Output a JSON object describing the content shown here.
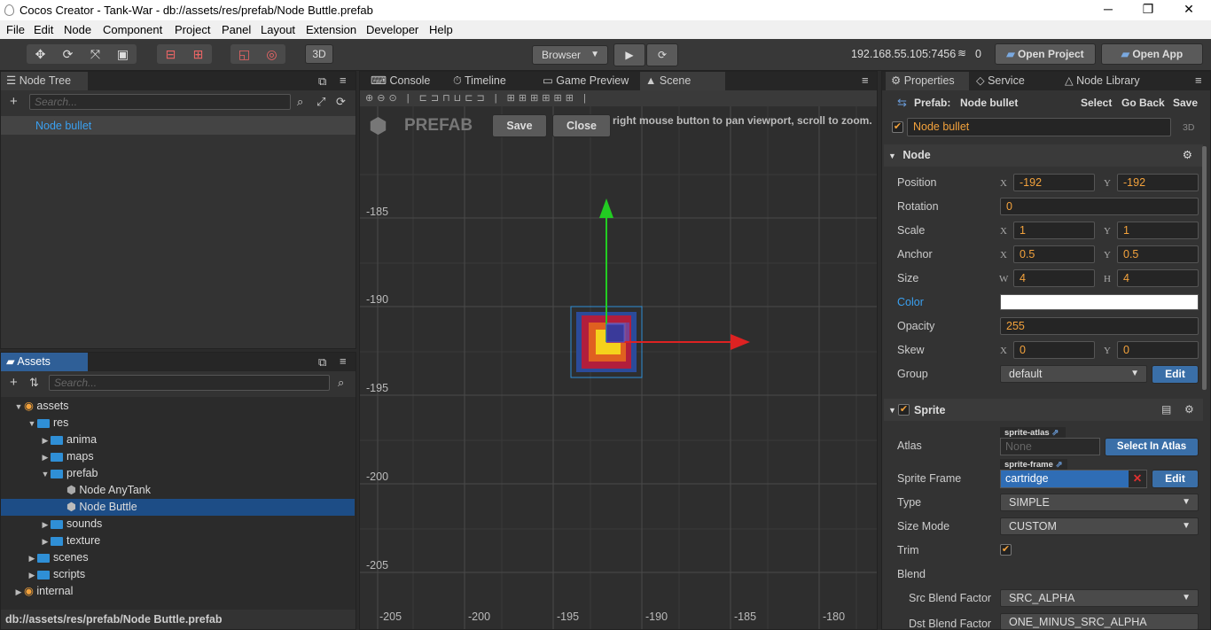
{
  "window": {
    "title": "Cocos Creator - Tank-War - db://assets/res/prefab/Node Buttle.prefab",
    "minimize": "─",
    "maximize": "❐",
    "close": "✕"
  },
  "menu": [
    "File",
    "Edit",
    "Node",
    "Component",
    "Project",
    "Panel",
    "Layout",
    "Extension",
    "Developer",
    "Help"
  ],
  "toolbar": {
    "mode3d": "3D",
    "browser": "Browser",
    "ip": "192.168.55.105:7456",
    "clients": "0",
    "open_project": "Open Project",
    "open_app": "Open App"
  },
  "node_tree": {
    "title": "Node Tree",
    "search_placeholder": "Search...",
    "items": [
      "Node bullet"
    ]
  },
  "assets": {
    "title": "Assets",
    "search_placeholder": "Search...",
    "path": "db://assets/res/prefab/Node Buttle.prefab",
    "items": [
      {
        "label": "assets"
      },
      {
        "label": "res"
      },
      {
        "label": "anima"
      },
      {
        "label": "maps"
      },
      {
        "label": "prefab"
      },
      {
        "label": "Node AnyTank"
      },
      {
        "label": "Node Buttle"
      },
      {
        "label": "sounds"
      },
      {
        "label": "texture"
      },
      {
        "label": "scenes"
      },
      {
        "label": "scripts"
      },
      {
        "label": "internal"
      }
    ]
  },
  "center_tabs": {
    "console": "Console",
    "timeline": "Timeline",
    "game_preview": "Game Preview",
    "scene": "Scene"
  },
  "scene": {
    "prefab_label": "PREFAB",
    "save": "Save",
    "close": "Close",
    "hint": "right mouse button to pan viewport, scroll to zoom.",
    "y_labels": [
      "-185",
      "-190",
      "-195",
      "-200",
      "-205"
    ],
    "x_labels": [
      "-205",
      "-200",
      "-195",
      "-190",
      "-185",
      "-180"
    ]
  },
  "right_tabs": {
    "properties": "Properties",
    "service": "Service",
    "node_library": "Node Library"
  },
  "properties": {
    "prefab_label": "Prefab:",
    "prefab_name": "Node bullet",
    "select": "Select",
    "go_back": "Go Back",
    "save": "Save",
    "node_name": "Node bullet",
    "badge3d": "3D",
    "node_section": "Node",
    "position_label": "Position",
    "pos_x": "-192",
    "pos_y": "-192",
    "rotation_label": "Rotation",
    "rotation": "0",
    "scale_label": "Scale",
    "scale_x": "1",
    "scale_y": "1",
    "anchor_label": "Anchor",
    "anchor_x": "0.5",
    "anchor_y": "0.5",
    "size_label": "Size",
    "size_w": "4",
    "size_h": "4",
    "color_label": "Color",
    "color_value": "#ffffff",
    "opacity_label": "Opacity",
    "opacity": "255",
    "skew_label": "Skew",
    "skew_x": "0",
    "skew_y": "0",
    "group_label": "Group",
    "group": "default",
    "group_edit": "Edit",
    "sprite_section": "Sprite",
    "atlas_label": "Atlas",
    "atlas_tag": "sprite-atlas",
    "atlas_value": "None",
    "select_in_atlas": "Select In Atlas",
    "sprite_frame_label": "Sprite Frame",
    "frame_tag": "sprite-frame",
    "frame_value": "cartridge",
    "frame_edit": "Edit",
    "type_label": "Type",
    "type": "SIMPLE",
    "size_mode_label": "Size Mode",
    "size_mode": "CUSTOM",
    "trim_label": "Trim",
    "blend_label": "Blend",
    "src_blend_label": "Src Blend Factor",
    "src_blend": "SRC_ALPHA",
    "dst_blend_label": "Dst Blend Factor",
    "dst_blend": "ONE_MINUS_SRC_ALPHA",
    "x": "X",
    "y": "Y",
    "w": "W",
    "h": "H"
  },
  "colors": {
    "accent_orange": "#f3a23c",
    "selection_blue": "#1d4d86",
    "link_blue": "#2f8fd6"
  }
}
